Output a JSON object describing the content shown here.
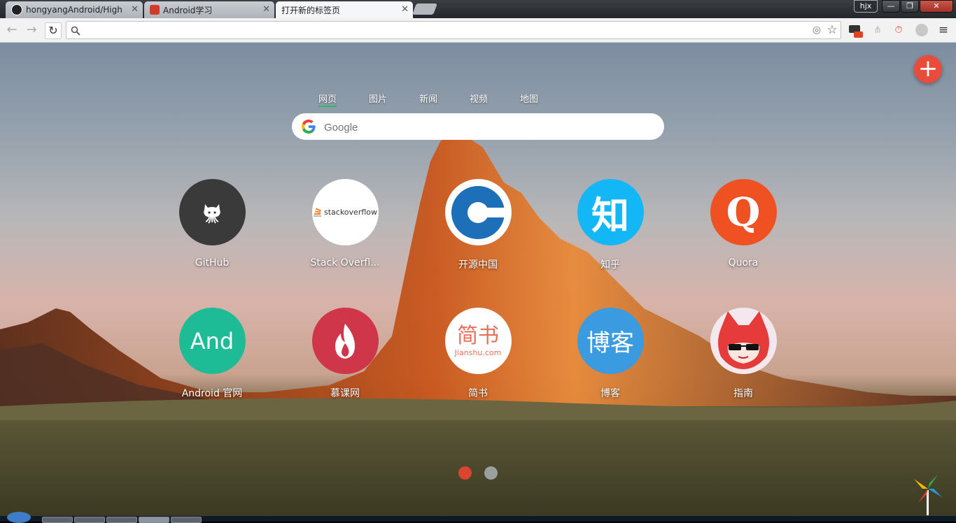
{
  "tabs": [
    {
      "title": "hongyangAndroid/High",
      "active": false
    },
    {
      "title": "Android学习",
      "active": false
    },
    {
      "title": "打开新的标签页",
      "active": true
    }
  ],
  "window": {
    "user": "hjx",
    "minimize": "—",
    "restore": "❐",
    "close": "✕"
  },
  "toolbar": {
    "omnibox_value": ""
  },
  "search": {
    "tabs": [
      "网页",
      "图片",
      "新闻",
      "视频",
      "地图"
    ],
    "active_tab": "网页",
    "placeholder": "Google"
  },
  "shortcuts": [
    {
      "label": "GitHub",
      "icon_text": "",
      "color": "#3a3a3a",
      "icon": "github-octocat-icon"
    },
    {
      "label": "Stack Overfl...",
      "icon_text": "stackoverflow",
      "color": "#ffffff",
      "icon": "stackoverflow-logo-icon"
    },
    {
      "label": "开源中国",
      "icon_text": "C",
      "color": "#ffffff",
      "icon": "oschina-logo-icon"
    },
    {
      "label": "知乎",
      "icon_text": "知",
      "color": "#13b7f5",
      "icon": "zhihu-logo-icon"
    },
    {
      "label": "Quora",
      "icon_text": "Q",
      "color": "#f05122",
      "icon": "quora-logo-icon"
    },
    {
      "label": "Android 官网",
      "icon_text": "And",
      "color": "#1ebc96",
      "icon": "android-text-icon"
    },
    {
      "label": "慕课网",
      "icon_text": "",
      "color": "#d0364a",
      "icon": "flame-icon"
    },
    {
      "label": "简书",
      "icon_text": "简书",
      "sub_text": "Jianshu.com",
      "color": "#ffffff",
      "icon": "jianshu-logo-icon"
    },
    {
      "label": "博客",
      "icon_text": "博客",
      "color": "#3a9be0",
      "icon": "blog-text-icon"
    },
    {
      "label": "指南",
      "icon_text": "",
      "color": "#e63b3b",
      "icon": "cartoon-fox-icon"
    }
  ],
  "pager": {
    "pages": 2,
    "current": 1,
    "active_color": "#d9452f",
    "inactive_color": "#9aa0a0"
  }
}
